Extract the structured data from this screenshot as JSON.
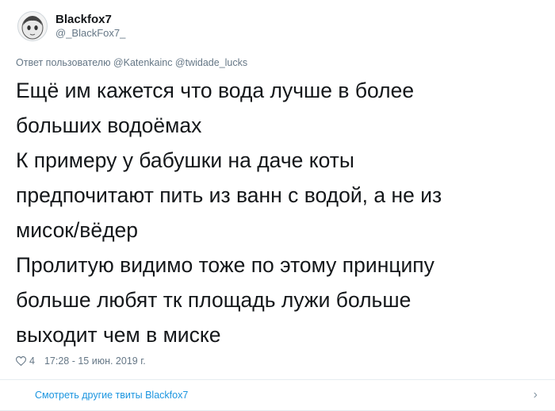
{
  "tweet": {
    "author": {
      "display_name": "Blackfox7",
      "handle": "@_BlackFox7_",
      "avatar_icon": "avatar-cartoon-girl"
    },
    "reply_to": "Ответ пользователю @Katenkainc @twidade_lucks",
    "text_lines": [
      "Ещё им кажется что вода лучше в более",
      "больших водоёмах",
      "К примеру у бабушки на даче коты",
      "предпочитают пить из ванн с водой, а не из",
      "мисок/вёдер",
      "Пролитую видимо тоже по этому принципу",
      "больше любят тк площадь лужи больше",
      "выходит чем в миске"
    ],
    "likes": "4",
    "timestamp": "17:28 - 15 июн. 2019 г."
  },
  "footer": {
    "more_tweets_label": "Смотреть другие твиты Blackfox7"
  },
  "colors": {
    "link": "#1b95e0",
    "muted": "#657786"
  }
}
